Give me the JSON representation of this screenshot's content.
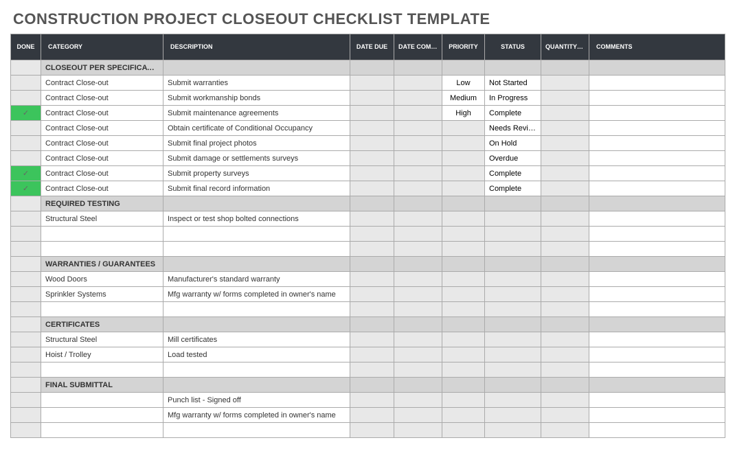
{
  "title": "CONSTRUCTION PROJECT CLOSEOUT CHECKLIST TEMPLATE",
  "columns": {
    "done": "DONE",
    "category": "CATEGORY",
    "description": "DESCRIPTION",
    "date_due": "DATE DUE",
    "date_completed": "DATE COMPLETED",
    "priority": "PRIORITY",
    "status": "STATUS",
    "quantity_requested": "QUANTITY REQUESTED",
    "comments": "COMMENTS"
  },
  "sections": [
    {
      "name": "CLOSEOUT PER SPECIFICATION",
      "rows": [
        {
          "done": false,
          "category": "Contract Close-out",
          "description": "Submit warranties",
          "date_due": "",
          "date_completed": "",
          "priority": "Low",
          "status": "Not Started",
          "quantity": "",
          "comments": ""
        },
        {
          "done": false,
          "category": "Contract Close-out",
          "description": "Submit workmanship bonds",
          "date_due": "",
          "date_completed": "",
          "priority": "Medium",
          "status": "In Progress",
          "quantity": "",
          "comments": ""
        },
        {
          "done": true,
          "category": "Contract Close-out",
          "description": "Submit maintenance agreements",
          "date_due": "",
          "date_completed": "",
          "priority": "High",
          "status": "Complete",
          "quantity": "",
          "comments": ""
        },
        {
          "done": false,
          "category": "Contract Close-out",
          "description": "Obtain certificate of Conditional Occupancy",
          "date_due": "",
          "date_completed": "",
          "priority": "",
          "status": "Needs Review",
          "quantity": "",
          "comments": ""
        },
        {
          "done": false,
          "category": "Contract Close-out",
          "description": "Submit final project photos",
          "date_due": "",
          "date_completed": "",
          "priority": "",
          "status": "On Hold",
          "quantity": "",
          "comments": ""
        },
        {
          "done": false,
          "category": "Contract Close-out",
          "description": "Submit damage or settlements surveys",
          "date_due": "",
          "date_completed": "",
          "priority": "",
          "status": "Overdue",
          "quantity": "",
          "comments": ""
        },
        {
          "done": true,
          "category": "Contract Close-out",
          "description": "Submit property surveys",
          "date_due": "",
          "date_completed": "",
          "priority": "",
          "status": "Complete",
          "quantity": "",
          "comments": ""
        },
        {
          "done": true,
          "category": "Contract Close-out",
          "description": "Submit final record information",
          "date_due": "",
          "date_completed": "",
          "priority": "",
          "status": "Complete",
          "quantity": "",
          "comments": ""
        }
      ]
    },
    {
      "name": "REQUIRED TESTING",
      "rows": [
        {
          "done": false,
          "category": "Structural Steel",
          "description": "Inspect or test shop bolted connections",
          "date_due": "",
          "date_completed": "",
          "priority": "",
          "status": "",
          "quantity": "",
          "comments": ""
        },
        {
          "done": false,
          "category": "",
          "description": "",
          "date_due": "",
          "date_completed": "",
          "priority": "",
          "status": "",
          "quantity": "",
          "comments": ""
        },
        {
          "done": false,
          "category": "",
          "description": "",
          "date_due": "",
          "date_completed": "",
          "priority": "",
          "status": "",
          "quantity": "",
          "comments": ""
        }
      ]
    },
    {
      "name": "WARRANTIES / GUARANTEES",
      "rows": [
        {
          "done": false,
          "category": "Wood Doors",
          "description": "Manufacturer's standard warranty",
          "date_due": "",
          "date_completed": "",
          "priority": "",
          "status": "",
          "quantity": "",
          "comments": ""
        },
        {
          "done": false,
          "category": "Sprinkler Systems",
          "description": "Mfg warranty w/ forms completed in owner's name",
          "date_due": "",
          "date_completed": "",
          "priority": "",
          "status": "",
          "quantity": "",
          "comments": ""
        },
        {
          "done": false,
          "category": "",
          "description": "",
          "date_due": "",
          "date_completed": "",
          "priority": "",
          "status": "",
          "quantity": "",
          "comments": ""
        }
      ]
    },
    {
      "name": "CERTIFICATES",
      "rows": [
        {
          "done": false,
          "category": "Structural Steel",
          "description": "Mill certificates",
          "date_due": "",
          "date_completed": "",
          "priority": "",
          "status": "",
          "quantity": "",
          "comments": ""
        },
        {
          "done": false,
          "category": "Hoist / Trolley",
          "description": "Load tested",
          "date_due": "",
          "date_completed": "",
          "priority": "",
          "status": "",
          "quantity": "",
          "comments": ""
        },
        {
          "done": false,
          "category": "",
          "description": "",
          "date_due": "",
          "date_completed": "",
          "priority": "",
          "status": "",
          "quantity": "",
          "comments": ""
        }
      ]
    },
    {
      "name": "FINAL SUBMITTAL",
      "rows": [
        {
          "done": false,
          "category": "",
          "description": "Punch list - Signed off",
          "date_due": "",
          "date_completed": "",
          "priority": "",
          "status": "",
          "quantity": "",
          "comments": ""
        },
        {
          "done": false,
          "category": "",
          "description": "Mfg warranty w/ forms completed in owner's name",
          "date_due": "",
          "date_completed": "",
          "priority": "",
          "status": "",
          "quantity": "",
          "comments": ""
        },
        {
          "done": false,
          "category": "",
          "description": "",
          "date_due": "",
          "date_completed": "",
          "priority": "",
          "status": "",
          "quantity": "",
          "comments": ""
        }
      ]
    }
  ],
  "priority_classes": {
    "Low": "prio-low",
    "Medium": "prio-med",
    "High": "prio-high"
  },
  "status_classes": {
    "Not Started": "stat-notstarted",
    "In Progress": "stat-inprogress",
    "Complete": "stat-complete",
    "Needs Review": "stat-needsreview",
    "On Hold": "stat-onhold",
    "Overdue": "stat-overdue"
  },
  "check_glyph": "✓"
}
